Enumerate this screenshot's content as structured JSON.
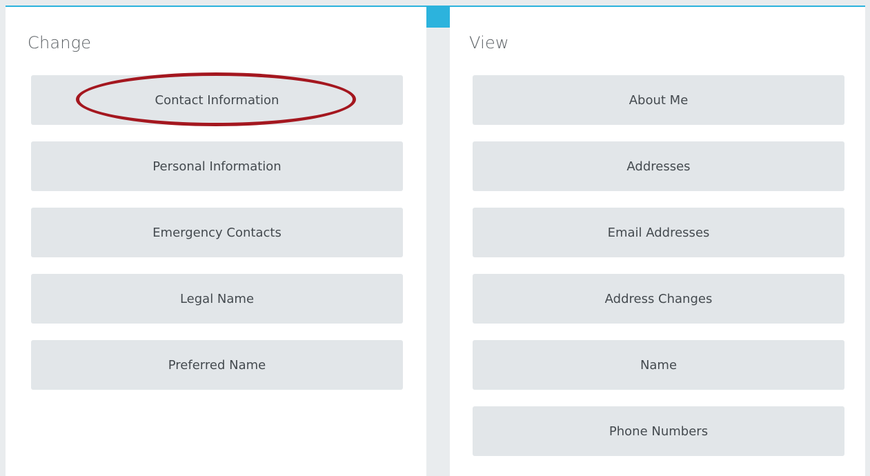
{
  "change": {
    "title": "Change",
    "buttons": [
      {
        "label": "Contact Information"
      },
      {
        "label": "Personal Information"
      },
      {
        "label": "Emergency Contacts"
      },
      {
        "label": "Legal Name"
      },
      {
        "label": "Preferred Name"
      }
    ]
  },
  "view": {
    "title": "View",
    "buttons": [
      {
        "label": "About Me"
      },
      {
        "label": "Addresses"
      },
      {
        "label": "Email Addresses"
      },
      {
        "label": "Address Changes"
      },
      {
        "label": "Name"
      },
      {
        "label": "Phone Numbers"
      }
    ]
  },
  "colors": {
    "accent": "#2cb3dd",
    "button_bg": "#e2e6e9",
    "highlight": "#a4171f"
  }
}
